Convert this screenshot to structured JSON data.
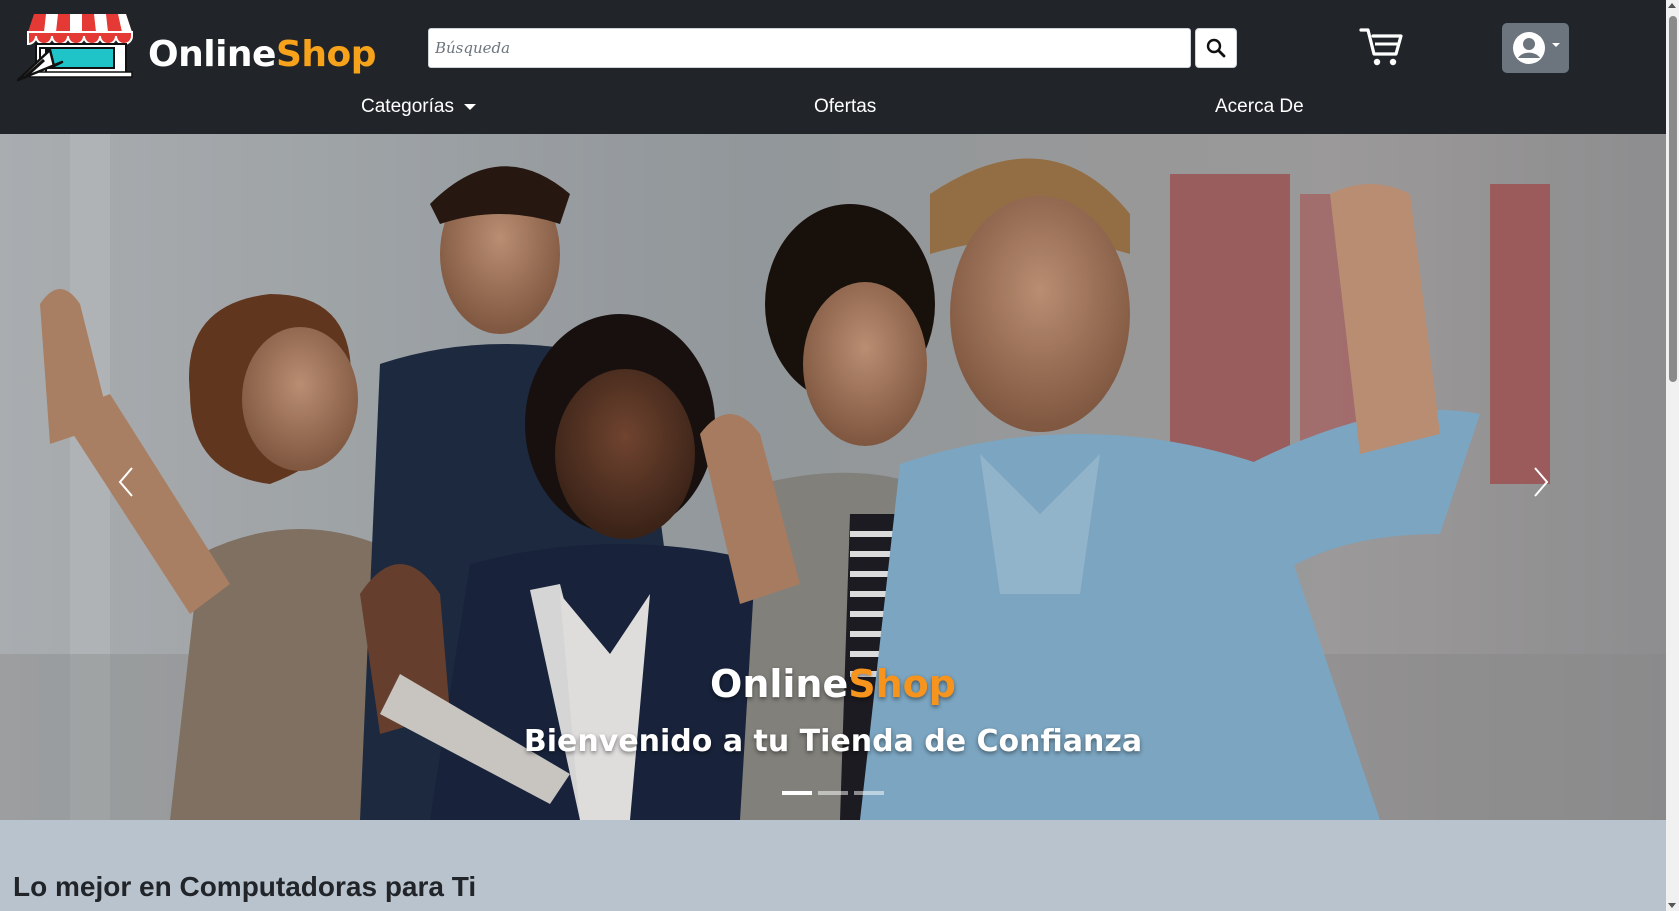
{
  "brand": {
    "part1": "Online",
    "part2": "Shop"
  },
  "search": {
    "placeholder": "Búsqueda",
    "value": ""
  },
  "icons": {
    "search": "search-icon",
    "cart": "cart-icon",
    "user": "user-circle-icon",
    "prev": "chevron-left-icon",
    "next": "chevron-right-icon"
  },
  "nav": {
    "categories": "Categorías",
    "offers": "Ofertas",
    "about": "Acerca De"
  },
  "carousel": {
    "brand_part1": "Online",
    "brand_part2": "Shop",
    "subtitle": "Bienvenido a tu Tienda de Confianza",
    "active_slide": 1,
    "slide_count": 3
  },
  "section": {
    "title": "Lo mejor en Computadoras para Ti"
  },
  "colors": {
    "header_bg": "#212529",
    "accent": "#f7941d",
    "page_bg": "#b9c3cd"
  }
}
